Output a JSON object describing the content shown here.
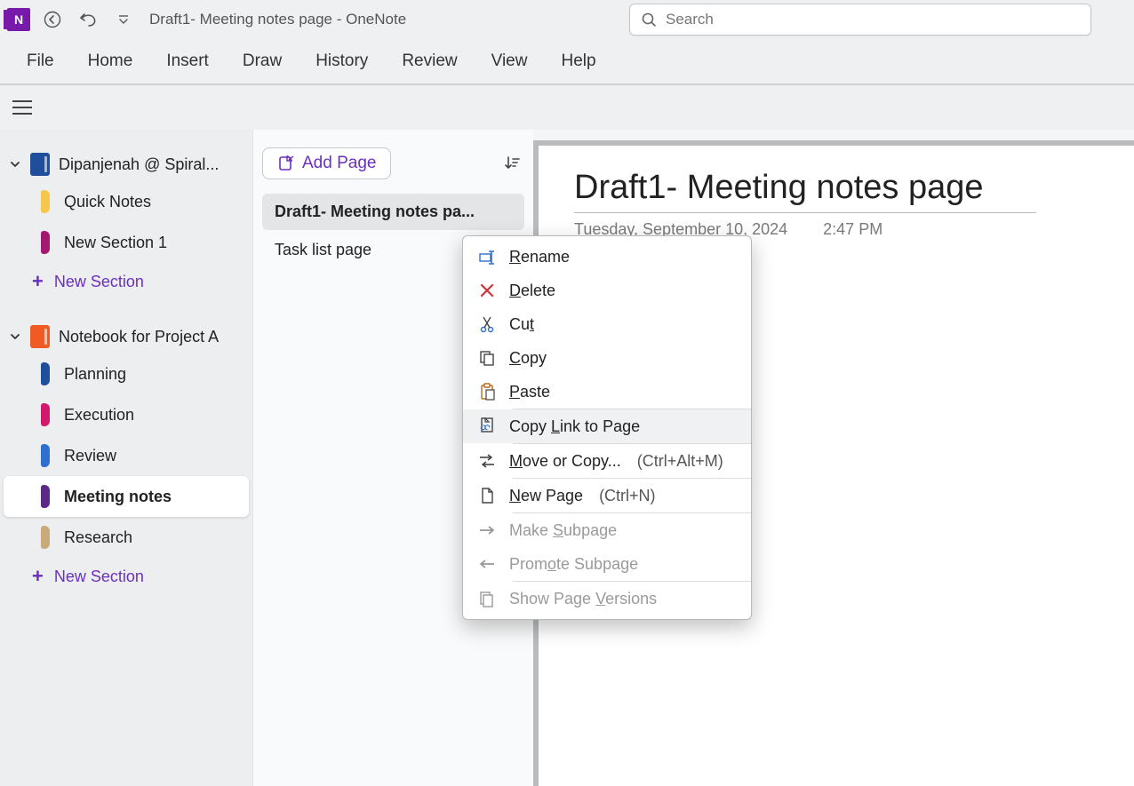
{
  "app": {
    "title": "Draft1- Meeting notes page  -  OneNote",
    "search_placeholder": "Search"
  },
  "ribbon": {
    "tabs": [
      "File",
      "Home",
      "Insert",
      "Draw",
      "History",
      "Review",
      "View",
      "Help"
    ]
  },
  "sidebar": {
    "notebooks": [
      {
        "name": "Dipanjenah @ Spiral...",
        "color": "#1f4e9c",
        "sections": [
          {
            "label": "Quick Notes",
            "color": "#f5c84c",
            "active": false
          },
          {
            "label": "New Section 1",
            "color": "#a3196f",
            "active": false
          }
        ]
      },
      {
        "name": "Notebook for Project A",
        "color": "#f05a23",
        "sections": [
          {
            "label": "Planning",
            "color": "#1f4e9c",
            "active": false
          },
          {
            "label": "Execution",
            "color": "#d11a6b",
            "active": false
          },
          {
            "label": "Review",
            "color": "#2f6fd0",
            "active": false
          },
          {
            "label": "Meeting notes",
            "color": "#5b2a86",
            "active": true
          },
          {
            "label": "Research",
            "color": "#caa97a",
            "active": false
          }
        ]
      }
    ],
    "new_section_label": "New Section"
  },
  "pagelist": {
    "add_page_label": "Add Page",
    "pages": [
      {
        "label": "Draft1- Meeting notes pa...",
        "selected": true
      },
      {
        "label": "Task list page",
        "selected": false
      }
    ]
  },
  "canvas": {
    "title": "Draft1- Meeting notes page",
    "date": "Tuesday, September 10, 2024",
    "time": "2:47 PM"
  },
  "context_menu": {
    "items": [
      {
        "label": "Rename",
        "mnemonic_index": 0,
        "icon": "rename",
        "hovered": false,
        "disabled": false
      },
      {
        "label": "Delete",
        "mnemonic_index": 0,
        "icon": "delete",
        "hovered": false,
        "disabled": false
      },
      {
        "label": "Cut",
        "mnemonic_index": 2,
        "icon": "cut",
        "hovered": false,
        "disabled": false
      },
      {
        "label": "Copy",
        "mnemonic_index": 0,
        "icon": "copy",
        "hovered": false,
        "disabled": false
      },
      {
        "label": "Paste",
        "mnemonic_index": 0,
        "icon": "paste",
        "hovered": false,
        "disabled": false
      },
      {
        "separator_above": true,
        "label": "Copy Link to Page",
        "mnemonic_index": 5,
        "icon": "link",
        "hovered": true,
        "disabled": false
      },
      {
        "separator_above": true,
        "label": "Move or Copy...",
        "mnemonic_index": 0,
        "icon": "move",
        "shortcut": "(Ctrl+Alt+M)",
        "hovered": false,
        "disabled": false
      },
      {
        "separator_above": true,
        "label": "New Page",
        "mnemonic_index": 0,
        "icon": "newpage",
        "shortcut": "(Ctrl+N)",
        "hovered": false,
        "disabled": false
      },
      {
        "separator_above": true,
        "label": "Make Subpage",
        "mnemonic_index": 5,
        "icon": "right",
        "hovered": false,
        "disabled": true
      },
      {
        "label": "Promote Subpage",
        "mnemonic_index": 4,
        "icon": "left",
        "hovered": false,
        "disabled": true
      },
      {
        "separator_above": true,
        "label": "Show Page Versions",
        "mnemonic_index": 10,
        "icon": "versions",
        "hovered": false,
        "disabled": true
      }
    ]
  }
}
